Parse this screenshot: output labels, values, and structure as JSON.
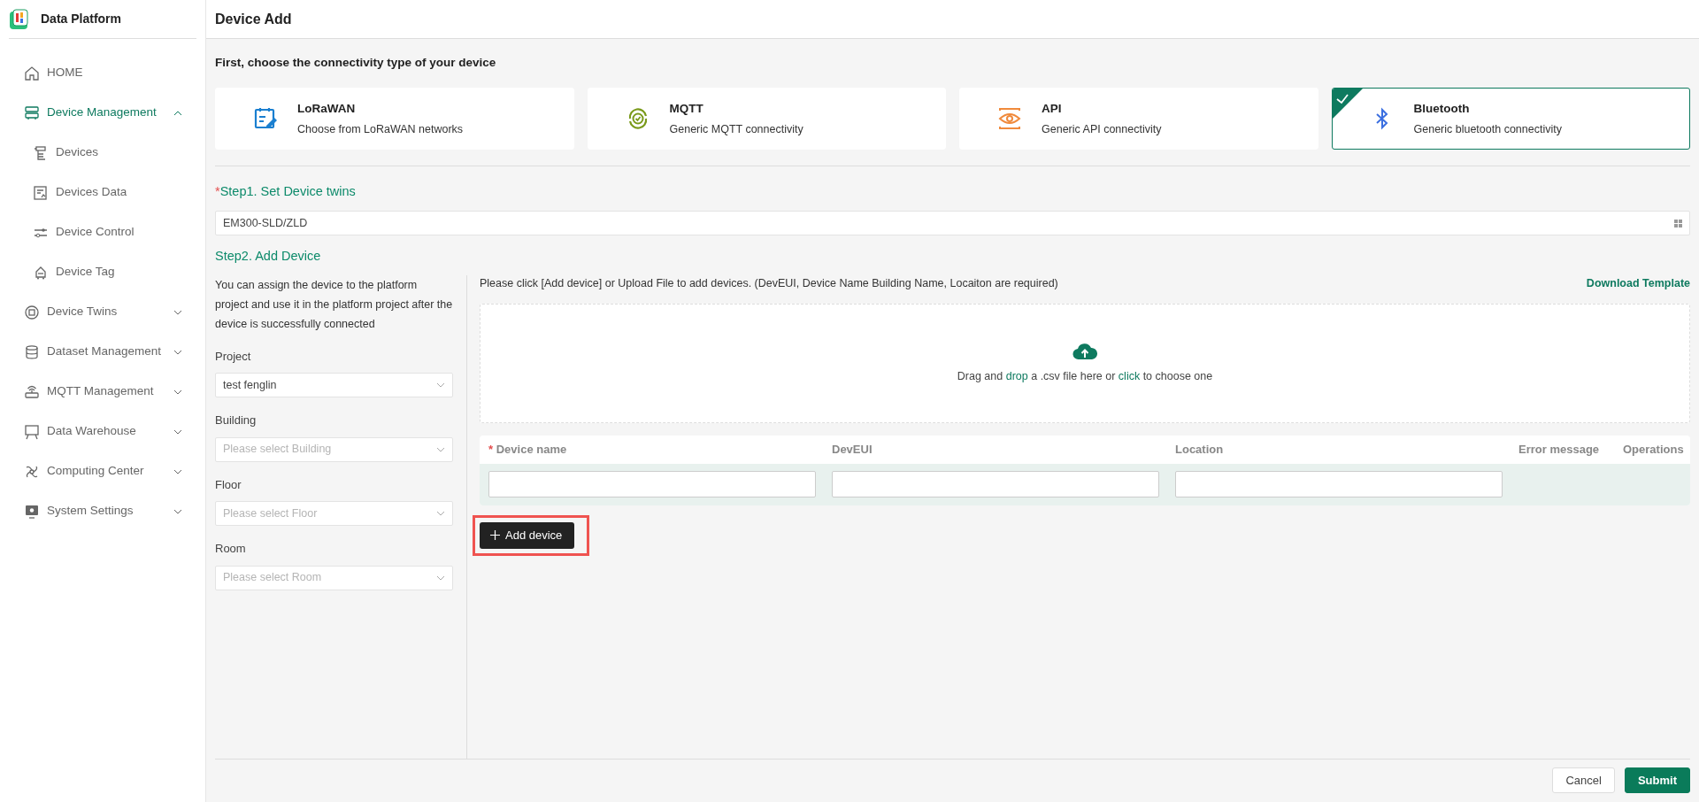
{
  "app": {
    "title": "Data Platform"
  },
  "sidebar": {
    "items": [
      {
        "label": "HOME",
        "selected": false
      },
      {
        "label": "Device Management",
        "selected": true,
        "expanded": true,
        "children": [
          {
            "label": "Devices",
            "selected": false
          },
          {
            "label": "Devices Data",
            "selected": false
          },
          {
            "label": "Device Control",
            "selected": false
          },
          {
            "label": "Device Tag",
            "selected": false
          }
        ]
      },
      {
        "label": "Device Twins",
        "selected": false,
        "expanded": false
      },
      {
        "label": "Dataset Management",
        "selected": false,
        "expanded": false
      },
      {
        "label": "MQTT Management",
        "selected": false,
        "expanded": false
      },
      {
        "label": "Data Warehouse",
        "selected": false,
        "expanded": false
      },
      {
        "label": "Computing Center",
        "selected": false,
        "expanded": false
      },
      {
        "label": "System Settings",
        "selected": false,
        "expanded": false
      }
    ]
  },
  "page": {
    "title": "Device Add"
  },
  "connectivity": {
    "heading": "First, choose the connectivity type of your device",
    "options": [
      {
        "title": "LoRaWAN",
        "description": "Choose from LoRaWAN networks",
        "selected": false
      },
      {
        "title": "MQTT",
        "description": "Generic MQTT connectivity",
        "selected": false
      },
      {
        "title": "API",
        "description": "Generic API connectivity",
        "selected": false
      },
      {
        "title": "Bluetooth",
        "description": "Generic bluetooth connectivity",
        "selected": true
      }
    ]
  },
  "step1": {
    "required_mark": "*",
    "label": "Step1. Set Device twins",
    "value": "EM300-SLD/ZLD"
  },
  "step2": {
    "label": "Step2. Add Device",
    "description": "You can assign the device to the platform project and use it in the platform project after the device is successfully connected",
    "fields": [
      {
        "label": "Project",
        "value": "test fenglin"
      },
      {
        "label": "Building",
        "placeholder": "Please select Building"
      },
      {
        "label": "Floor",
        "placeholder": "Please select Floor"
      },
      {
        "label": "Room",
        "placeholder": "Please select Room"
      }
    ],
    "instruction": "Please click [Add device] or Upload File to add devices. (DevEUI, Device Name Building Name, Locaiton are required)",
    "download_link": "Download Template",
    "dropzone": [
      {
        "kind": "text",
        "text": "Drag and "
      },
      {
        "kind": "link",
        "text": "drop"
      },
      {
        "kind": "text",
        "text": " a .csv file here or "
      },
      {
        "kind": "link",
        "text": "click"
      },
      {
        "kind": "text",
        "text": " to choose one"
      }
    ],
    "table": {
      "columns": [
        {
          "label": "Device name",
          "required": true,
          "kind": "input"
        },
        {
          "label": "DevEUI",
          "required": false,
          "kind": "input"
        },
        {
          "label": "Location",
          "required": false,
          "kind": "input"
        },
        {
          "label": "Error message",
          "required": false,
          "kind": "text"
        },
        {
          "label": "Operations",
          "required": false,
          "kind": "text"
        }
      ],
      "rows": [
        {
          "editable": true
        }
      ]
    },
    "add_button": {
      "label": "Add device",
      "highlighted": true
    }
  },
  "footer": {
    "buttons": [
      {
        "label": "Cancel",
        "kind": "secondary"
      },
      {
        "label": "Submit",
        "kind": "primary"
      }
    ]
  }
}
